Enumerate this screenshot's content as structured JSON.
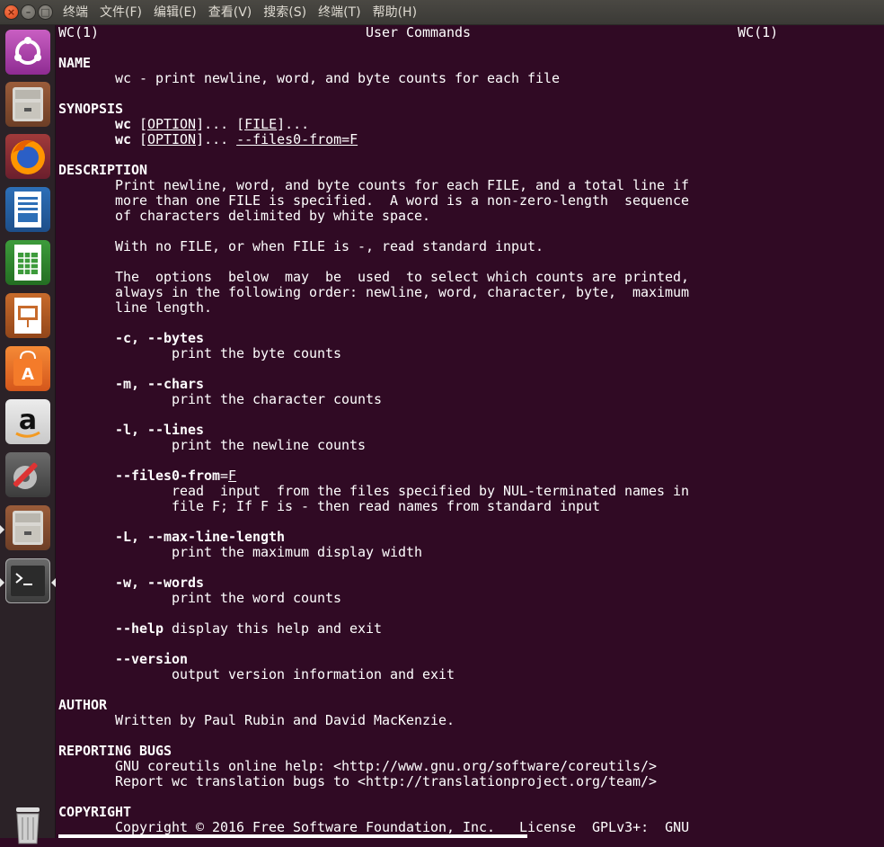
{
  "menu": {
    "items": [
      "终端",
      "文件(F)",
      "编辑(E)",
      "查看(V)",
      "搜索(S)",
      "终端(T)",
      "帮助(H)"
    ]
  },
  "launcher": {
    "apps": [
      "ubuntu-dash",
      "files",
      "firefox",
      "libreoffice-writer",
      "libreoffice-calc",
      "libreoffice-impress",
      "ubuntu-software",
      "amazon",
      "system-settings",
      "files",
      "terminal",
      "trash"
    ]
  },
  "man": {
    "header_left": "WC(1)",
    "header_center": "User Commands",
    "header_right": "WC(1)",
    "name_heading": "NAME",
    "name_text": "wc - print newline, word, and byte counts for each file",
    "synopsis_heading": "SYNOPSIS",
    "syn_cmd": "wc",
    "syn_option": "OPTION",
    "syn_dots": "...",
    "syn_file": "FILE",
    "syn_files0": "--files0-from=F",
    "description_heading": "DESCRIPTION",
    "desc_p1": "Print newline, word, and byte counts for each FILE, and a total line if\nmore than one FILE is specified.  A word is a non-zero-length  sequence\nof characters delimited by white space.",
    "desc_p2": "With no FILE, or when FILE is -, read standard input.",
    "desc_p3": "The  options  below  may  be  used  to select which counts are printed,\nalways in the following order: newline, word, character, byte,  maximum\nline length.",
    "opt_c": "-c, --bytes",
    "opt_c_desc": "print the byte counts",
    "opt_m": "-m, --chars",
    "opt_m_desc": "print the character counts",
    "opt_l": "-l, --lines",
    "opt_l_desc": "print the newline counts",
    "opt_files0": "--files0-from",
    "opt_files0_eq": "=",
    "opt_files0_arg": "F",
    "opt_files0_desc": "read  input  from the files specified by NUL-terminated names in\nfile F; If F is - then read names from standard input",
    "opt_L": "-L, --max-line-length",
    "opt_L_desc": "print the maximum display width",
    "opt_w": "-w, --words",
    "opt_w_desc": "print the word counts",
    "opt_help": "--help",
    "opt_help_desc": " display this help and exit",
    "opt_version": "--version",
    "opt_version_desc": "output version information and exit",
    "author_heading": "AUTHOR",
    "author_text": "Written by Paul Rubin and David MacKenzie.",
    "bugs_heading": "REPORTING BUGS",
    "bugs_text": "GNU coreutils online help: <http://www.gnu.org/software/coreutils/>\nReport wc translation bugs to <http://translationproject.org/team/>",
    "copyright_heading": "COPYRIGHT",
    "copyright_text": "Copyright © 2016 Free Software Foundation, Inc.   License  GPLv3+:  GNU"
  }
}
